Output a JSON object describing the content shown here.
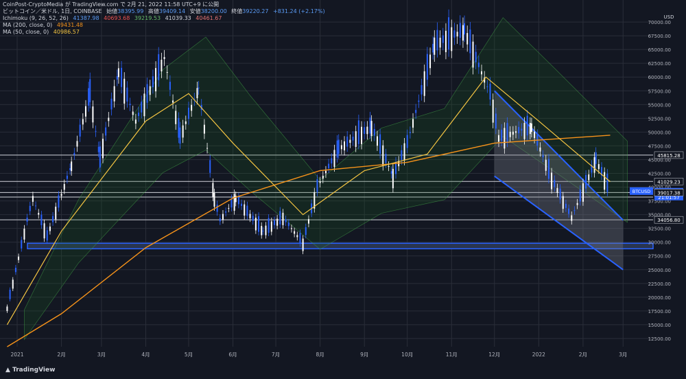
{
  "header": {
    "publisher_line": "CoinPost-CryptoMedia が TradingView.com で 2月 21, 2022 11:58 UTC+9 に公開",
    "symbol": "ビットコイン／米ドル, 1日, COINBASE",
    "open_label": "始値",
    "open_value": "38395.99",
    "high_label": "高値",
    "high_value": "39409.14",
    "low_label": "安値",
    "low_value": "38200.00",
    "close_label": "終値",
    "close_value": "39220.27",
    "change": "+831.24 (+2.17%)",
    "ichimoku_label": "Ichimoku (9, 26, 52, 26)",
    "ichimoku_values": [
      "41387.98",
      "40693.68",
      "39219.53",
      "41039.33",
      "40461.67"
    ],
    "ma200_label": "MA (200, close, 0)",
    "ma200_value": "49431.48",
    "ma50_label": "MA (50, close, 0)",
    "ma50_value": "40986.57"
  },
  "footer": {
    "logo_text": "TradingView"
  },
  "colors": {
    "background": "#131722",
    "up": "#ffffff",
    "down": "#2962ff",
    "ma200": "#f7931a",
    "ma50": "#f5c542",
    "ichimoku_conv": "#2962ff",
    "ichimoku_base": "#b71c1c",
    "ichimoku_lag": "#43a047",
    "cloud_bull": "#1b5e20",
    "cloud_bear": "#5d2a2a",
    "channel": "#2962ff"
  },
  "chart_data": {
    "type": "candlestick",
    "currency_label": "USD",
    "y_ticks": [
      12500,
      15000,
      17500,
      20000,
      22500,
      25000,
      27500,
      30000,
      32500,
      35000,
      37500,
      40000,
      42500,
      45000,
      47500,
      50000,
      52500,
      55000,
      57500,
      60000,
      62500,
      65000,
      67500,
      70000
    ],
    "x_ticks": [
      "2021",
      "2月",
      "3月",
      "4月",
      "5月",
      "6月",
      "7月",
      "8月",
      "9月",
      "10月",
      "11月",
      "12月",
      "2022",
      "2月",
      "3月"
    ],
    "ylim": [
      11000,
      74000
    ],
    "price_labels": [
      {
        "text": "45815.28",
        "value": 45815.28
      },
      {
        "text": "41029.23",
        "value": 41029.23
      },
      {
        "text": "39220.27",
        "value": 39220.27,
        "sub": "21:01:57",
        "tag": "BTCUSD"
      },
      {
        "text": "39017.38",
        "value": 39017.38
      },
      {
        "text": "34056.80",
        "value": 34056.8
      }
    ],
    "horizontal_levels": [
      45815.28,
      41029.23,
      39017.38,
      38200,
      34056.8
    ],
    "support_zone": [
      28800,
      29800
    ],
    "channel": {
      "upper": [
        [
          "2021-12-01",
          57500
        ],
        [
          "2022-03-01",
          34000
        ]
      ],
      "lower": [
        [
          "2021-12-01",
          42000
        ],
        [
          "2022-03-01",
          25000
        ]
      ]
    },
    "series": [
      {
        "name": "ビットコイン／米ドル",
        "points": [
          [
            "2020-12-25",
            18000
          ],
          [
            "2021-01-08",
            34000
          ],
          [
            "2021-01-12",
            38000
          ],
          [
            "2021-01-22",
            31000
          ],
          [
            "2021-02-08",
            44000
          ],
          [
            "2021-02-21",
            57000
          ],
          [
            "2021-02-28",
            45000
          ],
          [
            "2021-03-13",
            61000
          ],
          [
            "2021-03-25",
            52000
          ],
          [
            "2021-04-14",
            63500
          ],
          [
            "2021-04-25",
            49000
          ],
          [
            "2021-05-08",
            58000
          ],
          [
            "2021-05-19",
            38000
          ],
          [
            "2021-05-23",
            34000
          ],
          [
            "2021-06-03",
            38000
          ],
          [
            "2021-06-22",
            32000
          ],
          [
            "2021-07-06",
            34500
          ],
          [
            "2021-07-20",
            29800
          ],
          [
            "2021-07-30",
            40000
          ],
          [
            "2021-08-14",
            47000
          ],
          [
            "2021-09-06",
            51000
          ],
          [
            "2021-09-21",
            42000
          ],
          [
            "2021-10-01",
            48000
          ],
          [
            "2021-10-20",
            66000
          ],
          [
            "2021-11-10",
            68500
          ],
          [
            "2021-11-28",
            57000
          ],
          [
            "2021-12-04",
            49000
          ],
          [
            "2021-12-27",
            51000
          ],
          [
            "2022-01-10",
            41500
          ],
          [
            "2022-01-24",
            34500
          ],
          [
            "2022-02-10",
            45000
          ],
          [
            "2022-02-20",
            39220
          ]
        ]
      },
      {
        "name": "MA (200, close, 0)",
        "points": [
          [
            "2020-12-25",
            11000
          ],
          [
            "2021-02-01",
            17000
          ],
          [
            "2021-04-01",
            29000
          ],
          [
            "2021-06-01",
            38000
          ],
          [
            "2021-08-01",
            43000
          ],
          [
            "2021-10-01",
            44500
          ],
          [
            "2021-12-01",
            48000
          ],
          [
            "2022-02-20",
            49431
          ]
        ]
      },
      {
        "name": "MA (50, close, 0)",
        "points": [
          [
            "2020-12-25",
            15000
          ],
          [
            "2021-02-01",
            32000
          ],
          [
            "2021-04-01",
            52000
          ],
          [
            "2021-05-01",
            57000
          ],
          [
            "2021-06-01",
            48000
          ],
          [
            "2021-07-20",
            35000
          ],
          [
            "2021-09-01",
            43000
          ],
          [
            "2021-10-15",
            46000
          ],
          [
            "2021-11-25",
            60000
          ],
          [
            "2022-01-01",
            52000
          ],
          [
            "2022-02-20",
            40986
          ]
        ]
      }
    ]
  }
}
